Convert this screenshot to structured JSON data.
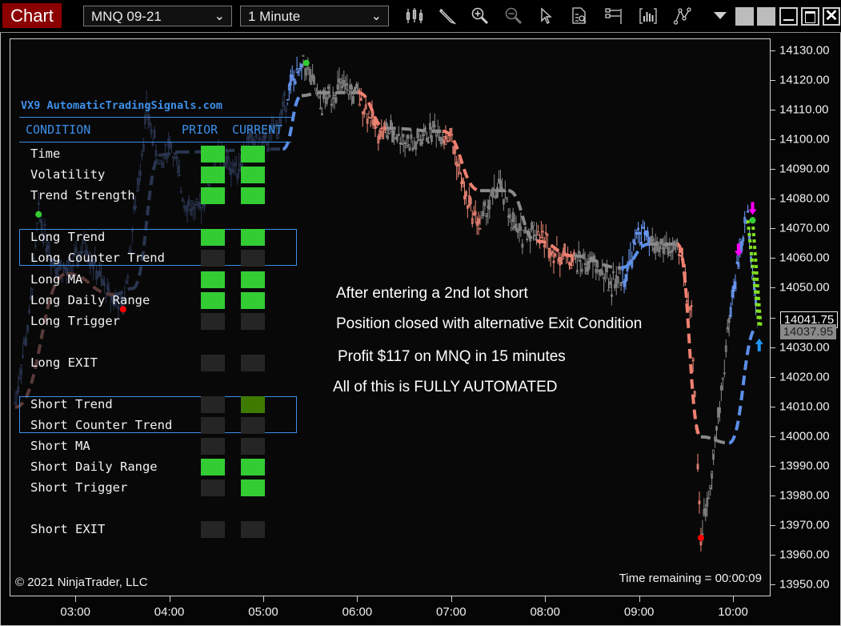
{
  "toolbar": {
    "title": "Chart",
    "instrument": "MNQ 09-21",
    "interval": "1 Minute",
    "icons": [
      "bar-type-icon",
      "pencil-draw-icon",
      "zoom-in-icon",
      "zoom-out-icon",
      "cursor-icon",
      "data-box-icon",
      "properties-icon",
      "indicators-icon",
      "strategies-icon"
    ]
  },
  "panel": {
    "title": "VX9 AutomaticTradingSignals.com",
    "headers": {
      "condition": "CONDITION",
      "prior": "PRIOR",
      "current": "CURRENT"
    },
    "colors": {
      "on": "#33cc33",
      "off": "#252525",
      "partial": "#3f7a00"
    },
    "rows": [
      {
        "label": "Time",
        "prior": "on",
        "current": "on"
      },
      {
        "label": "Volatility",
        "prior": "on",
        "current": "on"
      },
      {
        "label": "Trend Strength",
        "prior": "on",
        "current": "on"
      },
      {
        "label": "Long Trend",
        "prior": "on",
        "current": "on"
      },
      {
        "label": "Long Counter Trend",
        "prior": "off",
        "current": "off"
      },
      {
        "label": "Long MA",
        "prior": "on",
        "current": "on"
      },
      {
        "label": "Long Daily Range",
        "prior": "on",
        "current": "on"
      },
      {
        "label": "Long Trigger",
        "prior": "off",
        "current": "off"
      },
      {
        "label": "Long EXIT",
        "prior": "off",
        "current": "off"
      },
      {
        "label": "Short Trend",
        "prior": "off",
        "current": "partial"
      },
      {
        "label": "Short Counter Trend",
        "prior": "off",
        "current": "off"
      },
      {
        "label": "Short MA",
        "prior": "off",
        "current": "off"
      },
      {
        "label": "Short Daily Range",
        "prior": "on",
        "current": "on"
      },
      {
        "label": "Short Trigger",
        "prior": "off",
        "current": "on"
      },
      {
        "label": "Short EXIT",
        "prior": "off",
        "current": "off"
      }
    ]
  },
  "annotations": [
    "After entering a 2nd lot short",
    "Position closed with alternative Exit Condition",
    "Profit $117 on MNQ in 15 minutes",
    "All of this is FULLY AUTOMATED"
  ],
  "footer": {
    "copyright": "© 2021 NinjaTrader, LLC",
    "time_remaining": "Time remaining = 00:00:09"
  },
  "price": {
    "last": "14041.75",
    "average": "14037.95"
  },
  "chart_data": {
    "type": "candlestick",
    "instrument": "MNQ 09-21",
    "interval": "1 Minute",
    "y_ticks": [
      "14130.00",
      "14120.00",
      "14110.00",
      "14100.00",
      "14090.00",
      "14080.00",
      "14070.00",
      "14060.00",
      "14050.00",
      "14040.00",
      "14030.00",
      "14020.00",
      "14010.00",
      "14000.00",
      "13990.00",
      "13980.00",
      "13970.00",
      "13960.00",
      "13950.00"
    ],
    "y_range": [
      13946,
      14134
    ],
    "x_ticks": [
      "03:00",
      "04:00",
      "05:00",
      "06:00",
      "07:00",
      "08:00",
      "09:00",
      "10:00"
    ],
    "x_range_hours": [
      2.3,
      10.4
    ],
    "price_path": [
      [
        2.35,
        14012
      ],
      [
        2.5,
        14040
      ],
      [
        2.6,
        14075
      ],
      [
        2.75,
        14060
      ],
      [
        2.9,
        14055
      ],
      [
        3.1,
        14065
      ],
      [
        3.3,
        14050
      ],
      [
        3.5,
        14043
      ],
      [
        3.6,
        14070
      ],
      [
        3.75,
        14110
      ],
      [
        3.9,
        14090
      ],
      [
        4.0,
        14100
      ],
      [
        4.15,
        14080
      ],
      [
        4.3,
        14075
      ],
      [
        4.5,
        14095
      ],
      [
        4.7,
        14090
      ],
      [
        4.85,
        14100
      ],
      [
        5.0,
        14098
      ],
      [
        5.15,
        14105
      ],
      [
        5.3,
        14120
      ],
      [
        5.45,
        14125
      ],
      [
        5.6,
        14112
      ],
      [
        5.8,
        14118
      ],
      [
        6.0,
        14115
      ],
      [
        6.2,
        14104
      ],
      [
        6.4,
        14102
      ],
      [
        6.6,
        14098
      ],
      [
        6.8,
        14104
      ],
      [
        7.0,
        14100
      ],
      [
        7.15,
        14080
      ],
      [
        7.3,
        14072
      ],
      [
        7.5,
        14085
      ],
      [
        7.7,
        14068
      ],
      [
        7.9,
        14070
      ],
      [
        8.1,
        14062
      ],
      [
        8.3,
        14060
      ],
      [
        8.5,
        14058
      ],
      [
        8.7,
        14052
      ],
      [
        8.85,
        14055
      ],
      [
        9.0,
        14070
      ],
      [
        9.1,
        14065
      ],
      [
        9.3,
        14064
      ],
      [
        9.45,
        14060
      ],
      [
        9.55,
        14040
      ],
      [
        9.65,
        13966
      ],
      [
        9.75,
        13985
      ],
      [
        9.85,
        14010
      ],
      [
        9.95,
        14040
      ],
      [
        10.05,
        14060
      ],
      [
        10.15,
        14075
      ],
      [
        10.25,
        14040
      ]
    ],
    "trend_line": [
      [
        2.35,
        14010,
        "long"
      ],
      [
        2.9,
        14055,
        "short"
      ],
      [
        3.4,
        14048,
        "short"
      ],
      [
        3.6,
        14050,
        "long"
      ],
      [
        3.9,
        14095,
        "long"
      ],
      [
        4.1,
        14096,
        "neutral"
      ],
      [
        5.2,
        14097,
        "neutral"
      ],
      [
        5.4,
        14115,
        "long"
      ],
      [
        5.6,
        14116,
        "neutral"
      ],
      [
        6.0,
        14116,
        "neutral"
      ],
      [
        6.3,
        14104,
        "short"
      ],
      [
        6.9,
        14103,
        "neutral"
      ],
      [
        7.3,
        14083,
        "short"
      ],
      [
        7.6,
        14083,
        "neutral"
      ],
      [
        7.9,
        14066,
        "neutral"
      ],
      [
        8.3,
        14061,
        "short"
      ],
      [
        8.8,
        14057,
        "neutral"
      ],
      [
        9.1,
        14065,
        "long"
      ],
      [
        9.4,
        14065,
        "neutral"
      ],
      [
        9.65,
        14000,
        "short"
      ],
      [
        9.95,
        13998,
        "neutral"
      ],
      [
        10.25,
        14037,
        "long"
      ]
    ],
    "markers": [
      {
        "type": "dot",
        "color": "green",
        "x": 2.6,
        "y": 14075
      },
      {
        "type": "dot",
        "color": "red",
        "x": 3.5,
        "y": 14043
      },
      {
        "type": "dot",
        "color": "green",
        "x": 5.45,
        "y": 14126
      },
      {
        "type": "dot",
        "color": "red",
        "x": 9.65,
        "y": 13966
      },
      {
        "type": "dot",
        "color": "green",
        "x": 10.2,
        "y": 14073
      },
      {
        "type": "arrow-up",
        "color": "blue",
        "x": 10.27,
        "y": 14031
      },
      {
        "type": "arrow-down",
        "color": "magenta",
        "x": 10.2,
        "y": 14077
      },
      {
        "type": "arrow-down",
        "color": "magenta",
        "x": 10.05,
        "y": 14063
      }
    ],
    "exit_line": [
      [
        10.2,
        14073
      ],
      [
        10.27,
        14037
      ]
    ]
  }
}
